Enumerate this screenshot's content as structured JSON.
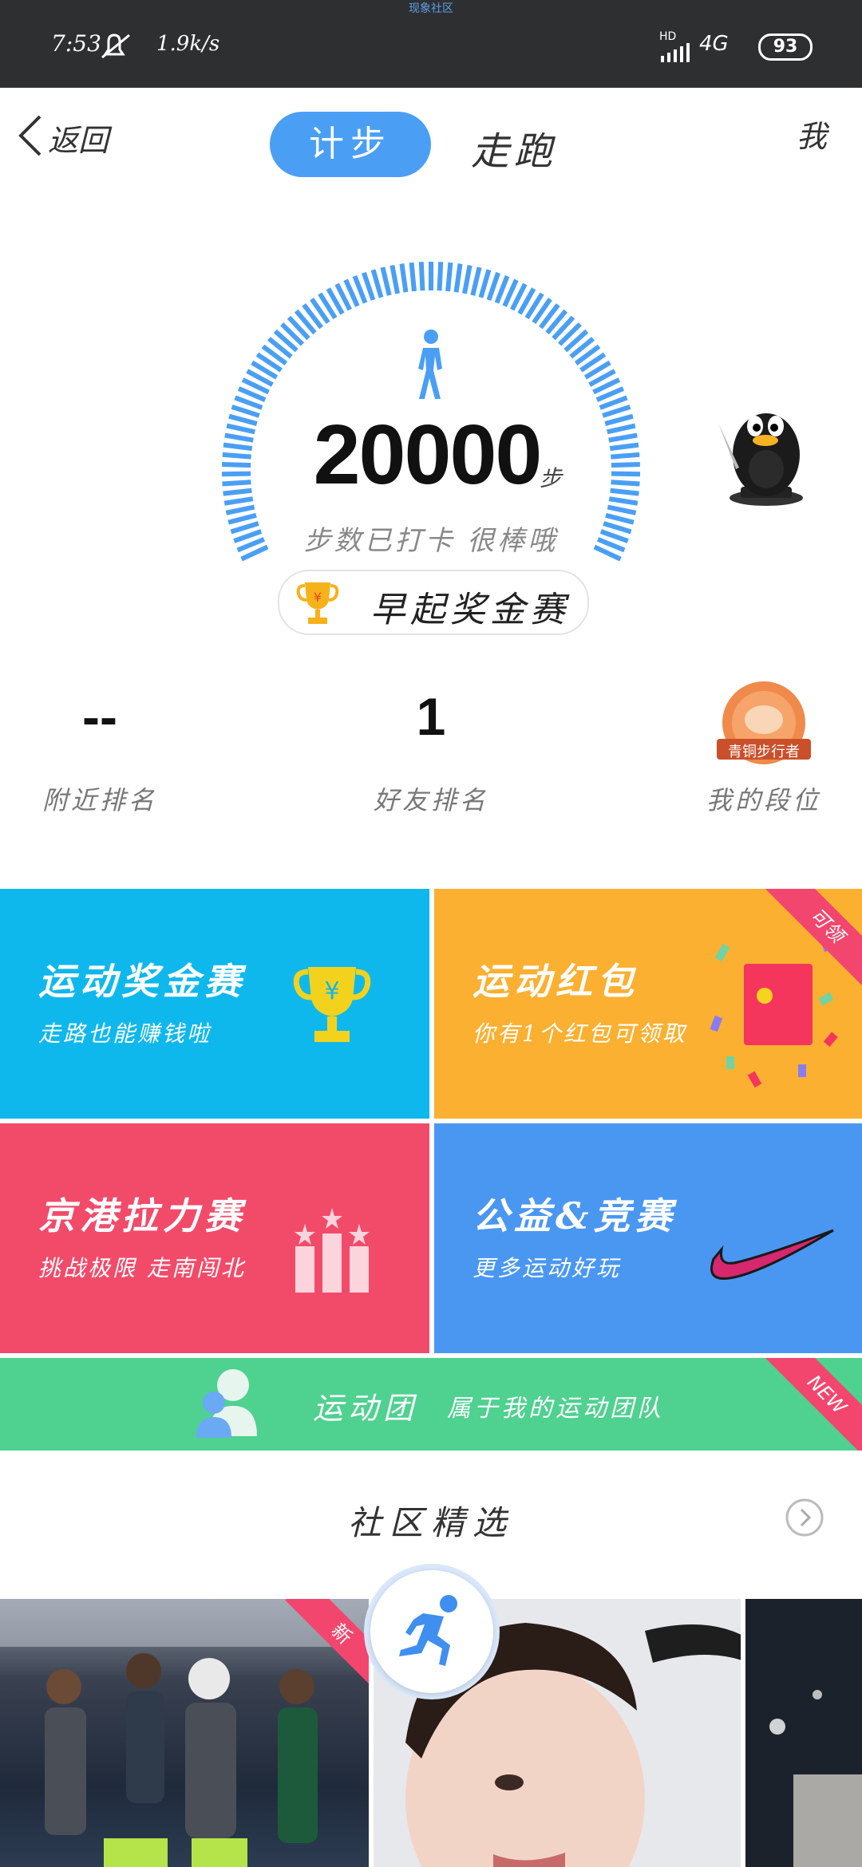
{
  "status_bar": {
    "carrier_tag": "现象社区",
    "time": "7:53",
    "speed": "1.9k/s",
    "network": "4G",
    "signal_label": "HD",
    "battery": "93"
  },
  "header": {
    "back_label": "返回",
    "tabs": [
      {
        "label": "计步",
        "active": true
      },
      {
        "label": "走跑",
        "active": false
      }
    ],
    "me_label": "我"
  },
  "steps": {
    "count": "20000",
    "unit": "步",
    "note": "步数已打卡  很棒哦",
    "early_contest": "早起奖金赛"
  },
  "rankings": [
    {
      "value": "--",
      "label": "附近排名"
    },
    {
      "value": "1",
      "label": "好友排名"
    },
    {
      "value": "",
      "label": "我的段位",
      "badge": "青铜步行者"
    }
  ],
  "tiles": [
    {
      "title": "运动奖金赛",
      "subtitle": "走路也能赚钱啦",
      "color": "#0fb8ec"
    },
    {
      "title": "运动红包",
      "subtitle": "你有1个红包可领取",
      "corner": "可领",
      "color": "#fbb032"
    },
    {
      "title": "京港拉力赛",
      "subtitle": "挑战极限  走南闯北",
      "color": "#f24b6a"
    },
    {
      "title": "公益&竞赛",
      "subtitle": "更多运动好玩",
      "color": "#4a97f2"
    }
  ],
  "team_banner": {
    "title": "运动团",
    "subtitle": "属于我的运动团队",
    "corner": "NEW",
    "color": "#4fd190"
  },
  "community": {
    "title": "社区精选",
    "new_badge": "新"
  },
  "icons": {
    "back": "chevron-left-icon",
    "walker": "walking-person-icon",
    "trophy": "trophy-icon",
    "runner": "running-person-icon",
    "arrow": "chevron-right-circle-icon"
  }
}
